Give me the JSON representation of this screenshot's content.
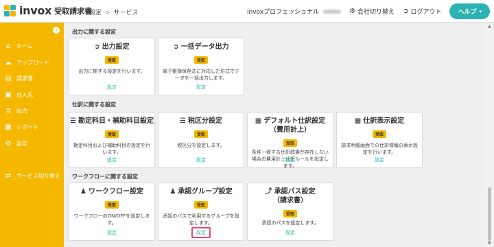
{
  "header": {
    "logo_text": "invox",
    "logo_sub": "受取請求書",
    "breadcrumb": [
      "設定",
      "サービス"
    ],
    "org_name": "invoxプロフェッショナル",
    "switch_company": "会社切り替え",
    "logout": "ログアウト",
    "help": "ヘルプ"
  },
  "sidebar": {
    "items": [
      {
        "label": "ホーム",
        "icon": "home-icon"
      },
      {
        "label": "アップロード",
        "icon": "cloud-upload-icon"
      },
      {
        "label": "請求書",
        "icon": "document-icon"
      },
      {
        "label": "仕入先",
        "icon": "building-icon"
      },
      {
        "label": "出力",
        "icon": "export-icon"
      },
      {
        "label": "レポート",
        "icon": "chart-icon"
      },
      {
        "label": "設定",
        "icon": "gear-icon"
      },
      {
        "label": "サービス切り替え",
        "icon": "switch-icon"
      }
    ]
  },
  "sections": {
    "output": {
      "title": "出力に関する設定",
      "cards": [
        {
          "title": "出力設定",
          "badge": "受取",
          "desc": "出力に関する設定を行います。",
          "link": "設定"
        },
        {
          "title": "一括データ出力",
          "badge": "受取",
          "desc": "電子帳簿保存法に対応した形式でデータを一括出力します。",
          "link": "設定"
        }
      ]
    },
    "journal": {
      "title": "仕訳に関する設定",
      "cards": [
        {
          "title": "勘定科目・補助科目設定",
          "badge": "受取",
          "desc": "勘定科目および補助科目の設定を行います。",
          "link": "設定"
        },
        {
          "title": "税区分設定",
          "badge": "受取",
          "desc": "税区分を設定します。",
          "link": "設定"
        },
        {
          "title": "デフォルト仕訳設定",
          "title2": "（費用計上）",
          "badge": "受取",
          "desc": "条件一致する仕訳辞書が存在しない場合の費用計上仕訳ルールを設定します。",
          "link": "設定"
        },
        {
          "title": "仕訳表示設定",
          "badge": "受取",
          "desc": "請求明細画面での仕訳情報の表示設定を行います。",
          "link": "設定"
        }
      ]
    },
    "workflow": {
      "title": "ワークフローに関する設定",
      "cards": [
        {
          "title": "ワークフロー設定",
          "badge": "受取",
          "desc": "ワークフローのON/OFFを設定します。",
          "link": "設定"
        },
        {
          "title": "承認グループ設定",
          "badge": "受取",
          "desc": "承認のパスで利用するグループを設定します。",
          "link": "設定"
        },
        {
          "title": "承認パス設定",
          "title2": "（請求書）",
          "badge": "受取",
          "desc": "承認のパスを設定します。",
          "link": "設定"
        }
      ]
    }
  },
  "colors": {
    "accent": "#f5b800",
    "link": "#2bb3b3",
    "highlight": "#e8497a"
  }
}
